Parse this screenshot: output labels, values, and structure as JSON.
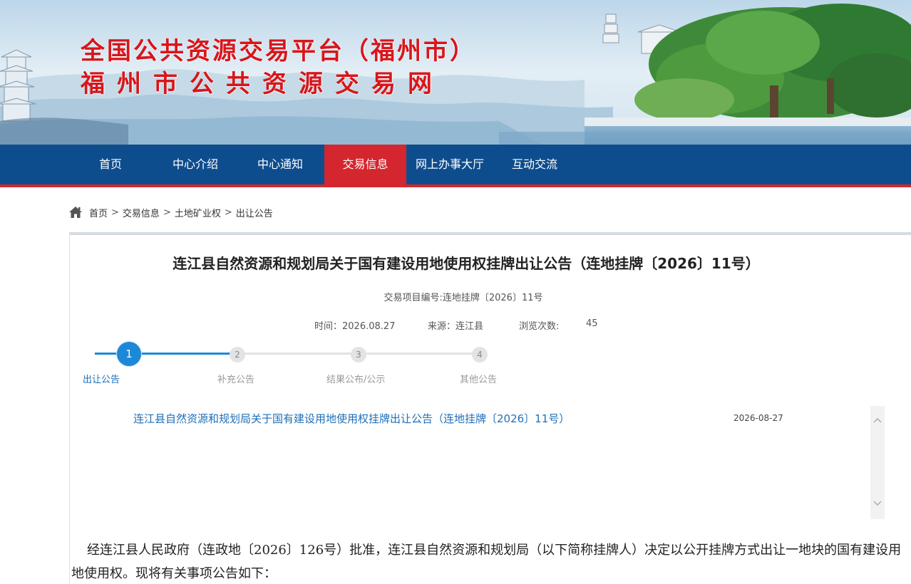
{
  "site": {
    "title_line1": "全国公共资源交易平台（福州市）",
    "title_line2": "福州市公共资源交易网"
  },
  "nav": {
    "items": [
      {
        "label": "首页"
      },
      {
        "label": "中心介绍"
      },
      {
        "label": "中心通知"
      },
      {
        "label": "交易信息"
      },
      {
        "label": "网上办事大厅"
      },
      {
        "label": "互动交流"
      }
    ],
    "active": "交易信息"
  },
  "breadcrumb": {
    "items": [
      "首页",
      "交易信息",
      "土地矿业权",
      "出让公告"
    ],
    "separator": ">"
  },
  "article": {
    "title": "连江县自然资源和规划局关于国有建设用地使用权挂牌出让公告（连地挂牌〔2026〕11号）",
    "trade_code": "交易项目编号:连地挂牌〔2026〕11号",
    "time_label": "时间：2026.08.27",
    "source_label": "来源：连江县",
    "views_label": "浏览次数:",
    "views_value": "45"
  },
  "steps": [
    {
      "number": "1",
      "label": "出让公告",
      "active": true
    },
    {
      "number": "2",
      "label": "补充公告",
      "active": false
    },
    {
      "number": "3",
      "label": "结果公布/公示",
      "active": false
    },
    {
      "number": "4",
      "label": "其他公告",
      "active": false
    }
  ],
  "announcements": [
    {
      "title": "连江县自然资源和规划局关于国有建设用地使用权挂牌出让公告（连地挂牌〔2026〕11号）",
      "date": "2026-08-27"
    }
  ],
  "scroll": {
    "up_icon": "chevron-up-icon",
    "down_icon": "chevron-down-icon"
  },
  "body": {
    "paragraph": "经连江县人民政府（连政地〔2026〕126号）批准，连江县自然资源和规划局（以下简称挂牌人）决定以公开挂牌方式出让一地块的国有建设用地使用权。现将有关事项公告如下："
  },
  "colors": {
    "brand_red": "#d7161b",
    "nav_blue": "#0e4d8d",
    "nav_active": "#d4262e",
    "link_blue": "#1e6fb8",
    "step_active": "#1e88d8"
  }
}
